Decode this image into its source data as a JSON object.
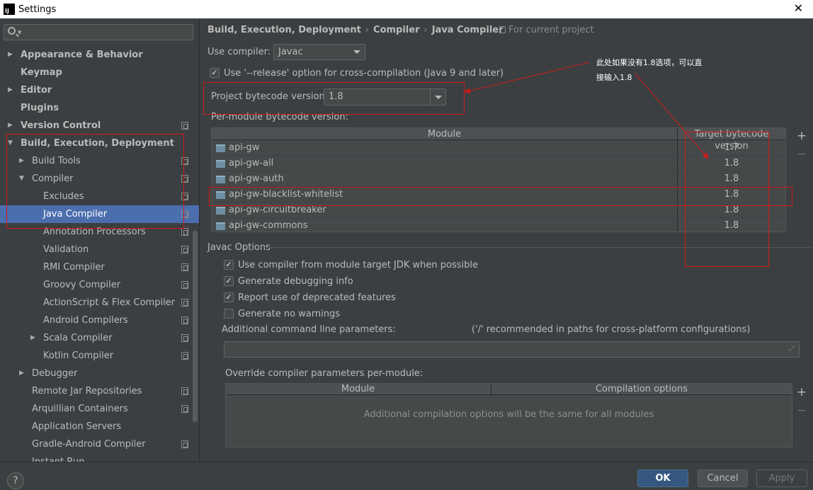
{
  "window": {
    "title": "Settings",
    "app_badge": "IJ"
  },
  "sidebar": {
    "items": [
      {
        "label": "Appearance & Behavior",
        "arrow": "▶",
        "bold": true
      },
      {
        "label": "Keymap",
        "bold": true
      },
      {
        "label": "Editor",
        "arrow": "▶",
        "bold": true
      },
      {
        "label": "Plugins",
        "bold": true
      },
      {
        "label": "Version Control",
        "arrow": "▶",
        "bold": true
      },
      {
        "label": "Build, Execution, Deployment",
        "arrow": "▼",
        "bold": true
      },
      {
        "label": "Build Tools",
        "arrow": "▶"
      },
      {
        "label": "Compiler",
        "arrow": "▼"
      },
      {
        "label": "Excludes"
      },
      {
        "label": "Java Compiler",
        "selected": true
      },
      {
        "label": "Annotation Processors"
      },
      {
        "label": "Validation"
      },
      {
        "label": "RMI Compiler"
      },
      {
        "label": "Groovy Compiler"
      },
      {
        "label": "ActionScript & Flex Compiler"
      },
      {
        "label": "Android Compilers"
      },
      {
        "label": "Scala Compiler",
        "arrow": "▶"
      },
      {
        "label": "Kotlin Compiler"
      },
      {
        "label": "Debugger",
        "arrow": "▶"
      },
      {
        "label": "Remote Jar Repositories"
      },
      {
        "label": "Arquillian Containers"
      },
      {
        "label": "Application Servers"
      },
      {
        "label": "Gradle-Android Compiler"
      },
      {
        "label": "Instant Run"
      }
    ]
  },
  "breadcrumb": {
    "part1": "Build, Execution, Deployment",
    "part2": "Compiler",
    "part3": "Java Compiler",
    "sep": "›"
  },
  "for_current_project": "For current project",
  "use_compiler": {
    "label": "Use compiler:",
    "value": "Javac"
  },
  "release_option": {
    "label": "Use '--release' option for cross-compilation (Java 9 and later)",
    "checked": true
  },
  "project_bytecode": {
    "label": "Project bytecode version:",
    "value": "1.8"
  },
  "per_module": {
    "label": "Per-module bytecode version:",
    "columns": [
      "Module",
      "Target bytecode version"
    ],
    "rows": [
      {
        "module": "api-gw",
        "version": "1.7"
      },
      {
        "module": "api-gw-all",
        "version": "1.8"
      },
      {
        "module": "api-gw-auth",
        "version": "1.8"
      },
      {
        "module": "api-gw-blacklist-whitelist",
        "version": "1.8"
      },
      {
        "module": "api-gw-circuitbreaker",
        "version": "1.8"
      },
      {
        "module": "api-gw-commons",
        "version": "1.8"
      }
    ],
    "add": "+",
    "remove": "−"
  },
  "javac": {
    "title": "Javac Options",
    "options": [
      {
        "label": "Use compiler from module target JDK when possible",
        "checked": true
      },
      {
        "label": "Generate debugging info",
        "checked": true
      },
      {
        "label": "Report use of deprecated features",
        "checked": true
      },
      {
        "label": "Generate no warnings",
        "checked": false
      }
    ],
    "additional_label": "Additional command line parameters:",
    "additional_hint": "('/' recommended in paths for cross-platform configurations)",
    "additional_value": ""
  },
  "override": {
    "label": "Override compiler parameters per-module:",
    "columns": [
      "Module",
      "Compilation options"
    ],
    "empty": "Additional compilation options will be the same for all modules",
    "add": "+",
    "remove": "−"
  },
  "buttons": {
    "help": "?",
    "ok": "OK",
    "cancel": "Cancel",
    "apply": "Apply"
  },
  "annotation": {
    "line1": "此处如果没有1.8选项，可以直",
    "line2": "接输入1.8",
    "color": "#d11a1a"
  },
  "colors": {
    "selection": "#4b6eaf",
    "panel": "#3c3f41",
    "ok_button": "#365880"
  }
}
